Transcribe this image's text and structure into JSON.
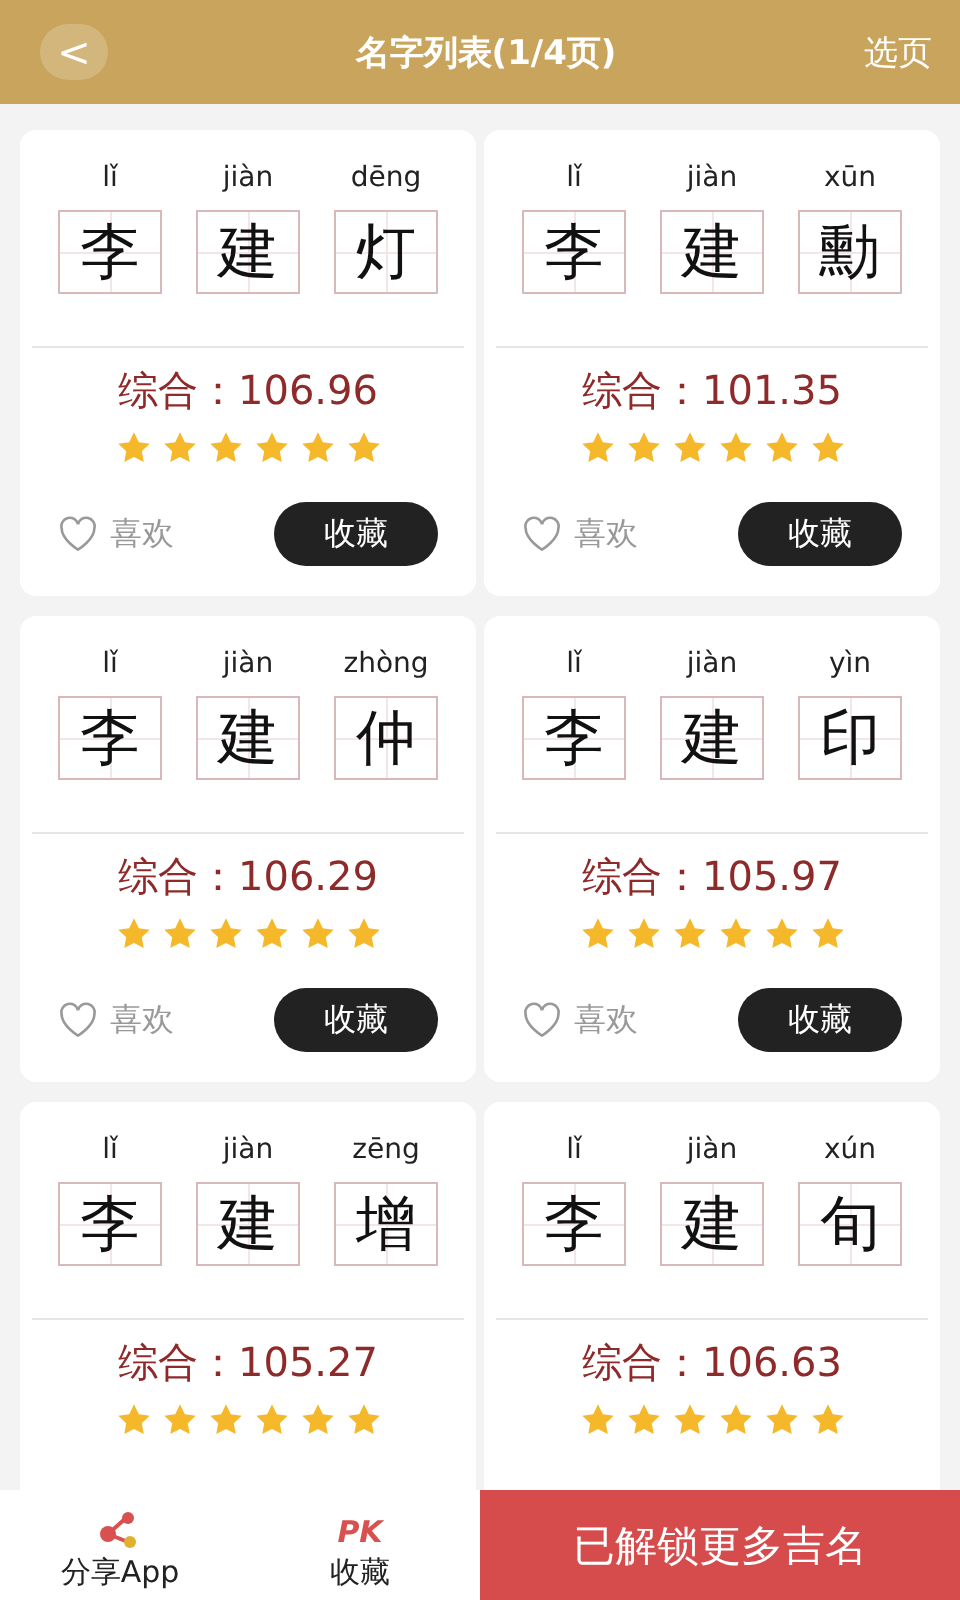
{
  "header": {
    "back": "<",
    "title": "名字列表(1/4页)",
    "action": "选页"
  },
  "names": [
    {
      "chars": [
        {
          "pinyin": "lǐ",
          "char": "李"
        },
        {
          "pinyin": "jiàn",
          "char": "建"
        },
        {
          "pinyin": "dēng",
          "char": "灯"
        }
      ],
      "score": "综合：106.96",
      "stars": 6,
      "like": {
        "label": "喜欢",
        "liked": false
      },
      "collect": "收藏"
    },
    {
      "chars": [
        {
          "pinyin": "lǐ",
          "char": "李"
        },
        {
          "pinyin": "jiàn",
          "char": "建"
        },
        {
          "pinyin": "xūn",
          "char": "勳"
        }
      ],
      "score": "综合：101.35",
      "stars": 6,
      "like": {
        "label": "喜欢",
        "liked": false
      },
      "collect": "收藏"
    },
    {
      "chars": [
        {
          "pinyin": "lǐ",
          "char": "李"
        },
        {
          "pinyin": "jiàn",
          "char": "建"
        },
        {
          "pinyin": "zhòng",
          "char": "仲"
        }
      ],
      "score": "综合：106.29",
      "stars": 6,
      "like": {
        "label": "喜欢",
        "liked": false
      },
      "collect": "收藏"
    },
    {
      "chars": [
        {
          "pinyin": "lǐ",
          "char": "李"
        },
        {
          "pinyin": "jiàn",
          "char": "建"
        },
        {
          "pinyin": "yìn",
          "char": "印"
        }
      ],
      "score": "综合：105.97",
      "stars": 6,
      "like": {
        "label": "喜欢",
        "liked": false
      },
      "collect": "收藏"
    },
    {
      "chars": [
        {
          "pinyin": "lǐ",
          "char": "李"
        },
        {
          "pinyin": "jiàn",
          "char": "建"
        },
        {
          "pinyin": "zēng",
          "char": "增"
        }
      ],
      "score": "综合：105.27",
      "stars": 6
    },
    {
      "chars": [
        {
          "pinyin": "lǐ",
          "char": "李"
        },
        {
          "pinyin": "jiàn",
          "char": "建"
        },
        {
          "pinyin": "xún",
          "char": "旬"
        }
      ],
      "score": "综合：106.63",
      "stars": 6
    }
  ],
  "bottom_bar": {
    "share": "分享App",
    "pk_badge": "PK",
    "favorites": "收藏",
    "unlock": "已解锁更多吉名"
  }
}
